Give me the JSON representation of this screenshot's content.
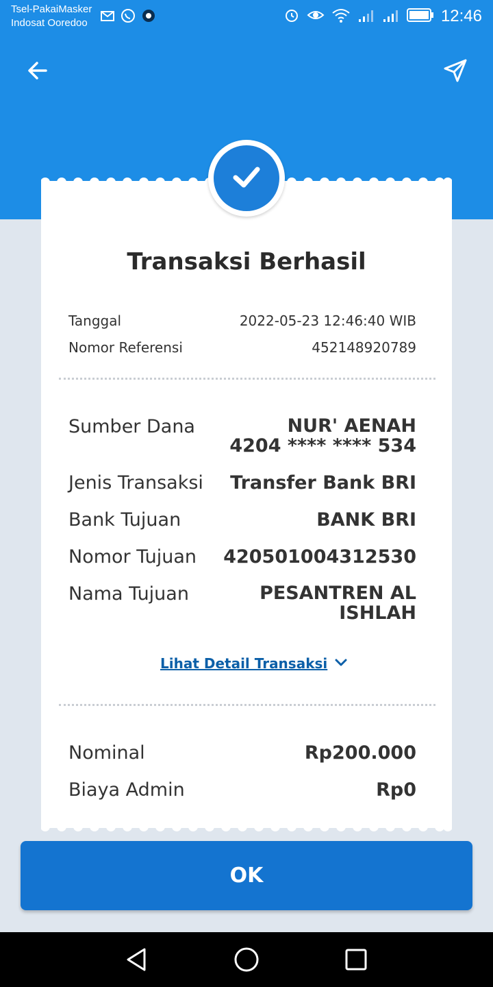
{
  "status_bar": {
    "carrier_line1": "Tsel-PakaiMasker",
    "carrier_line2": "Indosat Ooredoo",
    "time": "12:46"
  },
  "receipt": {
    "title": "Transaksi Berhasil",
    "meta": [
      {
        "label": "Tanggal",
        "value": "2022-05-23 12:46:40 WIB"
      },
      {
        "label": "Nomor Referensi",
        "value": "452148920789"
      }
    ],
    "source": {
      "label": "Sumber Dana",
      "name": "NUR' AENAH",
      "account": "4204 **** **** 534"
    },
    "details": [
      {
        "label": "Jenis Transaksi",
        "value": "Transfer Bank BRI"
      },
      {
        "label": "Bank Tujuan",
        "value": "BANK BRI"
      },
      {
        "label": "Nomor Tujuan",
        "value": "420501004312530"
      }
    ],
    "recipient": {
      "label": "Nama Tujuan",
      "line1": "PESANTREN AL",
      "line2": "ISHLAH"
    },
    "detail_link": "Lihat Detail Transaksi",
    "amounts": [
      {
        "label": "Nominal",
        "value": "Rp200.000"
      },
      {
        "label": "Biaya Admin",
        "value": "Rp0"
      }
    ]
  },
  "ok_button": "OK",
  "colors": {
    "primary": "#1d8de6",
    "button": "#1474d0",
    "link": "#0b5fa8"
  }
}
